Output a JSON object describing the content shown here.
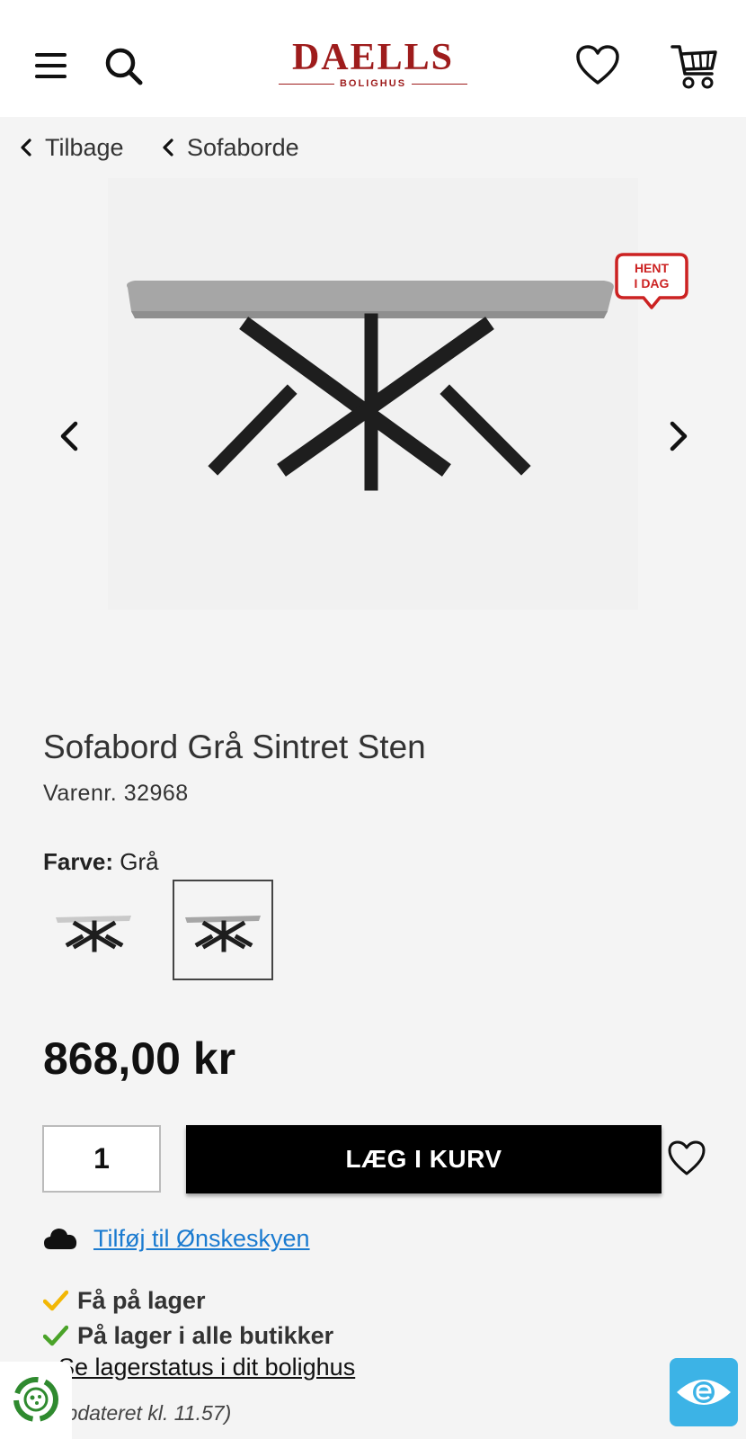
{
  "header": {
    "logo_main": "DAELLS",
    "logo_sub": "BOLIGHUS",
    "icons": [
      "menu-icon",
      "search-icon",
      "heart-icon",
      "cart-icon"
    ]
  },
  "breadcrumbs": {
    "back_label": "Tilbage",
    "category_label": "Sofaborde"
  },
  "gallery": {
    "badge_text": "HENT\nI DAG",
    "prev_icon": "chevron-left-icon",
    "next_icon": "chevron-right-icon"
  },
  "product": {
    "title": "Sofabord Grå Sintret Sten",
    "sku": "Varenr. 32968",
    "color_label": "Farve:",
    "color_value": "Grå",
    "price": "868,00 kr"
  },
  "purchase": {
    "quantity": "1",
    "add_to_cart_label": "LÆG I KURV",
    "wishlist_link": "Tilføj til Ønskeskyen"
  },
  "stock": {
    "line1": "Få på lager",
    "line2": "På lager i alle butikker",
    "store_link": "Se lagerstatus i dit bolighus",
    "updated": "(Opdateret kl. 11.57)"
  },
  "colors": {
    "brand_red": "#9e1c1c",
    "link_blue": "#1b7bd0",
    "check_yellow": "#f2b705",
    "check_green": "#4aa329",
    "accessibility_blue": "#3cb3e6"
  }
}
